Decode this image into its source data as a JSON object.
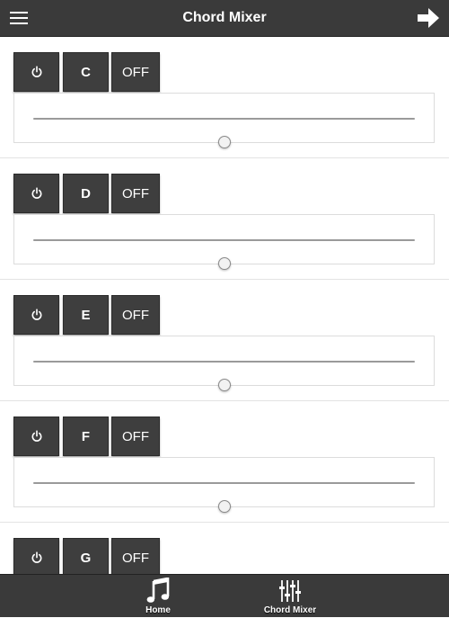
{
  "header": {
    "title": "Chord Mixer",
    "menu_icon": "hamburger-menu-icon",
    "forward_icon": "arrow-right-icon"
  },
  "channels": [
    {
      "chord": "C",
      "toggle_label": "OFF",
      "power_icon": "power-icon",
      "level": 0.5
    },
    {
      "chord": "D",
      "toggle_label": "OFF",
      "power_icon": "power-icon",
      "level": 0.5
    },
    {
      "chord": "E",
      "toggle_label": "OFF",
      "power_icon": "power-icon",
      "level": 0.5
    },
    {
      "chord": "F",
      "toggle_label": "OFF",
      "power_icon": "power-icon",
      "level": 0.5
    },
    {
      "chord": "G",
      "toggle_label": "OFF",
      "power_icon": "power-icon",
      "level": 0.5
    }
  ],
  "footer": {
    "items": [
      {
        "label": "Home",
        "icon": "music-note-icon"
      },
      {
        "label": "Chord Mixer",
        "icon": "mixer-sliders-icon"
      }
    ]
  },
  "colors": {
    "bar_background": "#3a3a3a",
    "button_background": "#3e3e3e",
    "slider_track": "#9a9a9a",
    "page_background": "#ffffff"
  }
}
